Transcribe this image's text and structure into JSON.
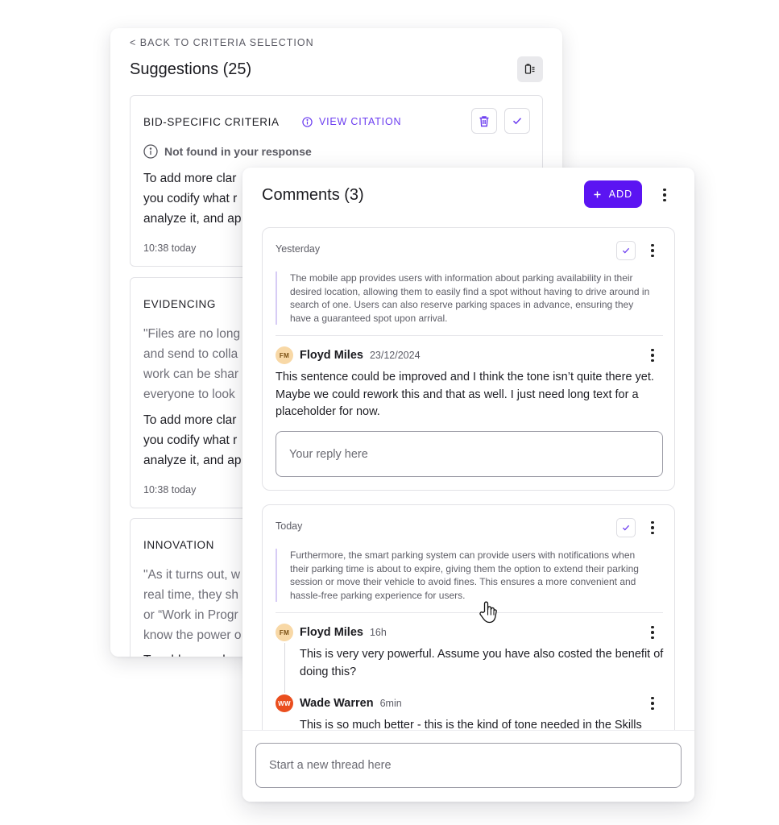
{
  "suggestions": {
    "back_label": "< BACK TO CRITERIA SELECTION",
    "title": "Suggestions (25)",
    "toolbar_icon": "clipboard-list-icon",
    "view_citation_label": "VIEW CITATION",
    "cards": [
      {
        "label": "BID-SPECIFIC CRITERIA",
        "status": "Not found in your response",
        "body_lines": [
          "To add more clar",
          "you codify what r",
          "analyze it, and ap"
        ],
        "time": "10:38 today"
      },
      {
        "label": "EVIDENCING",
        "quote_lines": [
          "\"Files are no long",
          "and send to colla",
          "work can be shar",
          "everyone to look"
        ],
        "body_lines": [
          "To add more clar",
          "you codify what r",
          "analyze it, and ap"
        ],
        "time": "10:38 today"
      },
      {
        "label": "INNOVATION",
        "quote_lines": [
          "\"As it turns out, w",
          "real time, they sh",
          "or “Work in Progr",
          "know the power o"
        ],
        "body_lines": [
          "To add more clar"
        ]
      }
    ]
  },
  "comments": {
    "title": "Comments (3)",
    "add_label": "ADD",
    "threads": [
      {
        "date": "Yesterday",
        "excerpt": "The mobile app provides users with information about parking availability in their desired location, allowing them to easily find a spot without having to drive around in search of one. Users can also reserve parking spaces in advance, ensuring they have a guaranteed spot upon arrival.",
        "comments": [
          {
            "initials": "FM",
            "author": "Floyd Miles",
            "time": "23/12/2024",
            "text": "This sentence could be improved and I think the tone isn’t quite there yet. Maybe we could rework this and that as well. I just need long text for a placeholder for now."
          }
        ],
        "reply_placeholder": "Your reply here"
      },
      {
        "date": "Today",
        "excerpt": "Furthermore, the smart parking system can provide users with notifications when their parking time is about to expire, giving them the option to extend their parking session or move their vehicle to avoid fines. This ensures a more convenient and hassle-free parking experience for users.",
        "comments": [
          {
            "initials": "FM",
            "author": "Floyd Miles",
            "time": "16h",
            "text": "This is very very powerful. Assume you have also costed the benefit of doing this?"
          },
          {
            "initials": "WW",
            "author": "Wade Warren",
            "time": "6min",
            "text": "This is so much better - this is the kind of tone needed in the Skills"
          }
        ]
      }
    ],
    "new_thread_placeholder": "Start a new thread here"
  },
  "colors": {
    "accent": "#5b14f2",
    "link": "#6b3cf0",
    "excerpt_bar": "#d7ccf5"
  }
}
